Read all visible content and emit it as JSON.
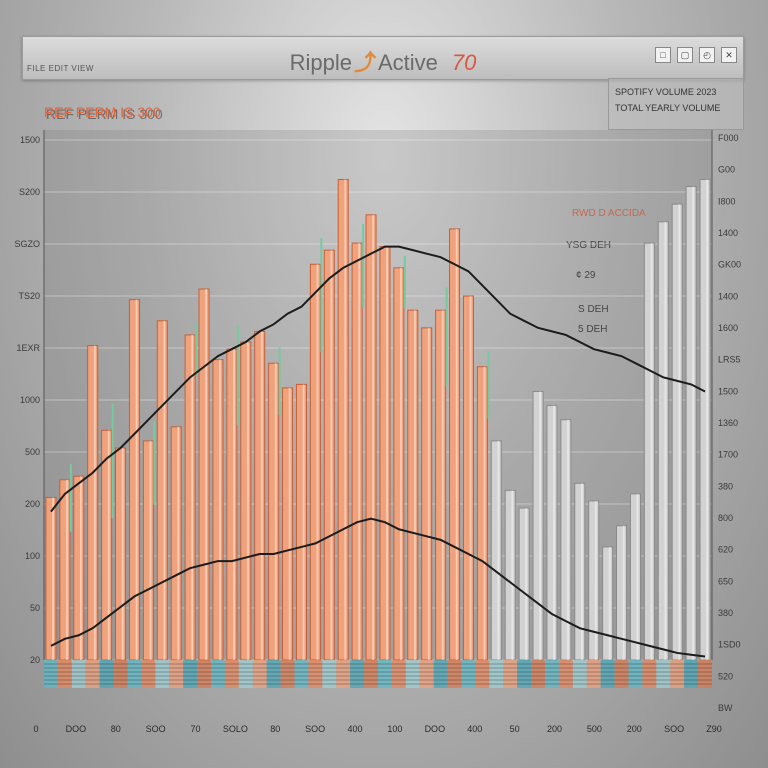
{
  "window": {
    "title_left": "Ripple",
    "title_right": "Active",
    "title_number": "70",
    "menu_label": "FILE EDIT VIEW",
    "controls": [
      "□",
      "▢",
      "◴",
      "✕"
    ]
  },
  "info_panel": {
    "line1": "SPOTIFY VOLUME 2023",
    "line2": "TOTAL YEARLY VOLUME"
  },
  "ylabel_top": "REF PERM IS 300",
  "annotations": [
    {
      "text": "RWD D ACCIDA",
      "color": "orange"
    },
    {
      "text": "YSG DEH"
    },
    {
      "text": "¢ 29"
    },
    {
      "text": "S DEH"
    },
    {
      "text": "5 DEH"
    }
  ],
  "chart_data": {
    "type": "bar",
    "left_ticks": [
      "1500",
      "S200",
      "SGZO",
      "TS20",
      "1EXR",
      "1000",
      "500",
      "200",
      "100",
      "50",
      "20"
    ],
    "right_ticks": [
      "F000",
      "G00",
      "I800",
      "1400",
      "GK00",
      "1400",
      "1600",
      "LRS5",
      "1500",
      "1360",
      "1700",
      "380",
      "800",
      "620",
      "650",
      "380",
      "1SD0",
      "520",
      "BW"
    ],
    "x_ticks": [
      "0",
      "DOO",
      "80",
      "SOO",
      "70",
      "SOLO",
      "80",
      "SOO",
      "400",
      "100",
      "DOO",
      "400",
      "50",
      "200",
      "500",
      "200",
      "SOO",
      "Z90"
    ],
    "ylim": [
      0,
      1500
    ],
    "grid": true,
    "colors": {
      "orange": "#f0a27c",
      "orange_dark": "#c4603a",
      "grey": "#d2d2d2",
      "grey_dark": "#8a8a8a",
      "spike": "#77c9a0",
      "line": "#1c1c1c"
    },
    "series": [
      {
        "values": [
          460,
          510,
          520,
          890,
          650,
          600,
          1020,
          620,
          960,
          660,
          920,
          1050,
          850,
          880,
          900,
          930,
          840,
          770,
          780,
          1120,
          1160,
          1360,
          1180,
          1260,
          1170,
          1110,
          990,
          940,
          990,
          1220,
          1030,
          830,
          620,
          480,
          430,
          760,
          720,
          680,
          500,
          450,
          320,
          380,
          470,
          1180,
          1240,
          1290,
          1340,
          1360
        ]
      },
      {
        "values": [
          420,
          470,
          500,
          530,
          570,
          600,
          640,
          680,
          720,
          760,
          800,
          830,
          860,
          880,
          900,
          930,
          950,
          980,
          1000,
          1040,
          1080,
          1110,
          1130,
          1150,
          1170,
          1170,
          1160,
          1150,
          1140,
          1120,
          1100,
          1060,
          1020,
          980,
          960,
          940,
          930,
          920,
          900,
          880,
          870,
          860,
          840,
          820,
          800,
          790,
          780,
          760
        ]
      },
      {
        "values": [
          40,
          60,
          70,
          90,
          120,
          150,
          180,
          200,
          220,
          240,
          260,
          270,
          280,
          280,
          290,
          300,
          300,
          310,
          320,
          330,
          350,
          370,
          390,
          400,
          390,
          370,
          360,
          350,
          340,
          320,
          300,
          280,
          250,
          220,
          190,
          160,
          130,
          110,
          90,
          80,
          70,
          60,
          50,
          40,
          30,
          20,
          15,
          10
        ]
      }
    ]
  }
}
